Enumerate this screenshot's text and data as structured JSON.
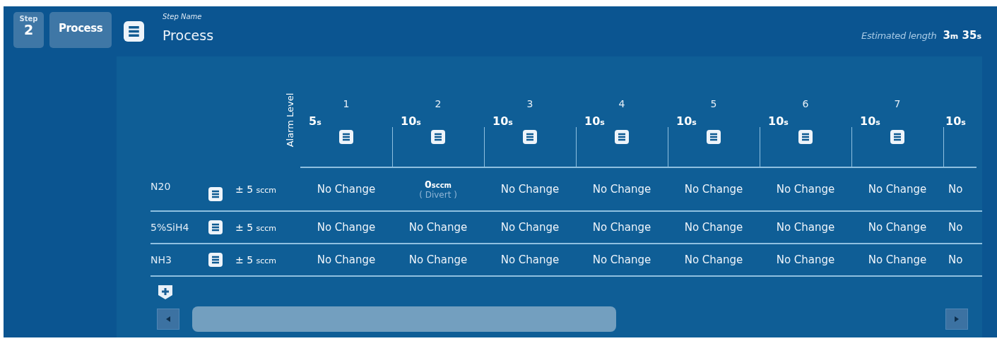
{
  "step": {
    "label": "Step",
    "number": "2"
  },
  "step_type_button": "Process",
  "step_name": {
    "label": "Step Name",
    "value": "Process"
  },
  "estimated_length": {
    "label": "Estimated length",
    "parts": [
      {
        "value": "3",
        "unit": "m"
      },
      {
        "value": "35",
        "unit": "s"
      }
    ]
  },
  "table": {
    "alarm_header": "Alarm Level",
    "columns": [
      {
        "number": "1",
        "duration": "5",
        "unit": "s",
        "notes_icon": true
      },
      {
        "number": "2",
        "duration": "10",
        "unit": "s",
        "notes_icon": true
      },
      {
        "number": "3",
        "duration": "10",
        "unit": "s",
        "notes_icon": true
      },
      {
        "number": "4",
        "duration": "10",
        "unit": "s",
        "notes_icon": true
      },
      {
        "number": "5",
        "duration": "10",
        "unit": "s",
        "notes_icon": true
      },
      {
        "number": "6",
        "duration": "10",
        "unit": "s",
        "notes_icon": true
      },
      {
        "number": "7",
        "duration": "10",
        "unit": "s",
        "notes_icon": true
      },
      {
        "duration": "10",
        "unit": "s",
        "notes_icon": false
      }
    ],
    "rows": [
      {
        "gas": "N20",
        "alarm": "± 5",
        "alarm_unit": "sccm",
        "cells": [
          {
            "kind": "text",
            "text": "No Change"
          },
          {
            "kind": "setpoint",
            "value": "0",
            "unit": "sccm",
            "note": "( Divert )"
          },
          {
            "kind": "text",
            "text": "No Change"
          },
          {
            "kind": "text",
            "text": "No Change"
          },
          {
            "kind": "text",
            "text": "No Change"
          },
          {
            "kind": "text",
            "text": "No Change"
          },
          {
            "kind": "text",
            "text": "No Change"
          },
          {
            "kind": "text",
            "text": "No"
          }
        ]
      },
      {
        "gas": "5%SiH4",
        "alarm": "± 5",
        "alarm_unit": "sccm",
        "cells": [
          {
            "kind": "text",
            "text": "No Change"
          },
          {
            "kind": "text",
            "text": "No Change"
          },
          {
            "kind": "text",
            "text": "No Change"
          },
          {
            "kind": "text",
            "text": "No Change"
          },
          {
            "kind": "text",
            "text": "No Change"
          },
          {
            "kind": "text",
            "text": "No Change"
          },
          {
            "kind": "text",
            "text": "No Change"
          },
          {
            "kind": "text",
            "text": "No"
          }
        ]
      },
      {
        "gas": "NH3",
        "alarm": "± 5",
        "alarm_unit": "sccm",
        "cells": [
          {
            "kind": "text",
            "text": "No Change"
          },
          {
            "kind": "text",
            "text": "No Change"
          },
          {
            "kind": "text",
            "text": "No Change"
          },
          {
            "kind": "text",
            "text": "No Change"
          },
          {
            "kind": "text",
            "text": "No Change"
          },
          {
            "kind": "text",
            "text": "No Change"
          },
          {
            "kind": "text",
            "text": "No Change"
          },
          {
            "kind": "text",
            "text": "No"
          }
        ]
      }
    ]
  }
}
